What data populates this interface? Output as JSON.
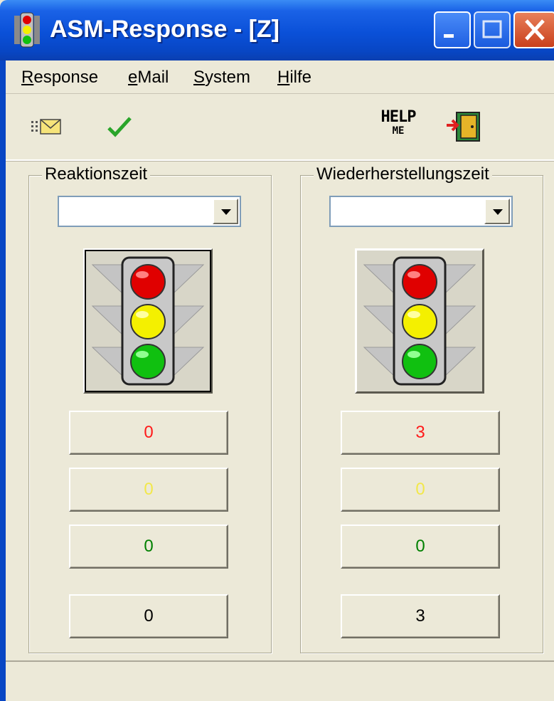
{
  "window": {
    "title": "ASM-Response - [Z]",
    "app_icon": "traffic-light-icon",
    "controls": [
      "minimize",
      "maximize",
      "close"
    ]
  },
  "menu": [
    {
      "label": "Response",
      "mnemonic": "R"
    },
    {
      "label": "eMail",
      "mnemonic": "e"
    },
    {
      "label": "System",
      "mnemonic": "S"
    },
    {
      "label": "Hilfe",
      "mnemonic": "H"
    }
  ],
  "toolbar": {
    "left_icons": [
      "mail-icon",
      "checkmark-icon"
    ],
    "help_text_top": "HELP",
    "help_text_bottom": "ME",
    "exit_icon": "exit-door-icon"
  },
  "groups": {
    "left": {
      "label": "Reaktionszeit",
      "selected": "",
      "counts": {
        "red": "0",
        "yellow": "0",
        "green": "0",
        "total": "0"
      }
    },
    "right": {
      "label": "Wiederherstellungszeit",
      "selected": "",
      "counts": {
        "red": "3",
        "yellow": "0",
        "green": "0",
        "total": "3"
      }
    }
  },
  "colors": {
    "red_text": "#ff1a1a",
    "yellow_text": "#f2e84a",
    "green_text": "#008000",
    "total_text": "#000000",
    "light_red": "#e00000",
    "light_yellow": "#f4f000",
    "light_green": "#10c010"
  },
  "status": ""
}
